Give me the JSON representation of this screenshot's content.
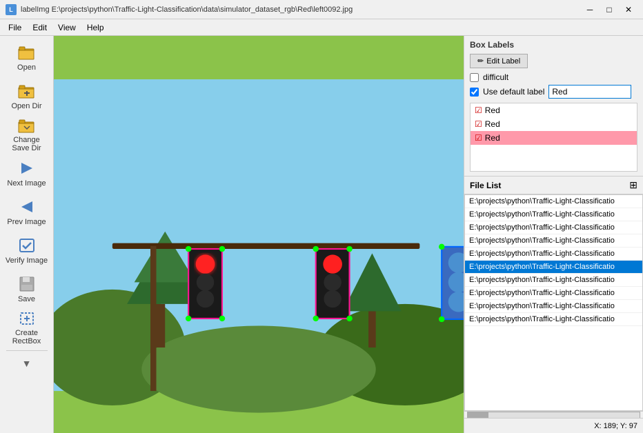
{
  "titleBar": {
    "icon": "L",
    "title": "labelImg  E:\\projects\\python\\Traffic-Light-Classification\\data\\simulator_dataset_rgb\\Red\\left0092.jpg",
    "controls": [
      "─",
      "□",
      "✕"
    ]
  },
  "menuBar": {
    "items": [
      "File",
      "Edit",
      "View",
      "Help"
    ]
  },
  "toolbar": {
    "items": [
      {
        "id": "open",
        "label": "Open",
        "icon": "open"
      },
      {
        "id": "opendir",
        "label": "Open Dir",
        "icon": "opendir"
      },
      {
        "id": "changedir",
        "label": "Change Save Dir",
        "icon": "changedir"
      },
      {
        "id": "next",
        "label": "Next Image",
        "icon": "next"
      },
      {
        "id": "prev",
        "label": "Prev Image",
        "icon": "prev"
      },
      {
        "id": "verify",
        "label": "Verify Image",
        "icon": "verify"
      },
      {
        "id": "save",
        "label": "Save",
        "icon": "save"
      },
      {
        "id": "create",
        "label": "Create RectBox",
        "icon": "create"
      }
    ]
  },
  "rightPanel": {
    "boxLabels": {
      "title": "Box Labels",
      "editLabelBtn": "Edit Label",
      "difficultLabel": "difficult",
      "difficultChecked": false,
      "useDefaultLabel": "Use default label",
      "useDefaultChecked": true,
      "defaultLabelValue": "Red",
      "labels": [
        {
          "text": "Red",
          "checked": true,
          "selected": false
        },
        {
          "text": "Red",
          "checked": true,
          "selected": false
        },
        {
          "text": "Red",
          "checked": true,
          "selected": true
        }
      ]
    },
    "fileList": {
      "title": "File List",
      "items": [
        {
          "text": "E:\\projects\\python\\Traffic-Light-Classificatio",
          "selected": false
        },
        {
          "text": "E:\\projects\\python\\Traffic-Light-Classificatio",
          "selected": false
        },
        {
          "text": "E:\\projects\\python\\Traffic-Light-Classificatio",
          "selected": false
        },
        {
          "text": "E:\\projects\\python\\Traffic-Light-Classificatio",
          "selected": false
        },
        {
          "text": "E:\\projects\\python\\Traffic-Light-Classificatio",
          "selected": false
        },
        {
          "text": "E:\\projects\\python\\Traffic-Light-Classificatio",
          "selected": true
        },
        {
          "text": "E:\\projects\\python\\Traffic-Light-Classificatio",
          "selected": false
        },
        {
          "text": "E:\\projects\\python\\Traffic-Light-Classificatio",
          "selected": false
        },
        {
          "text": "E:\\projects\\python\\Traffic-Light-Classificatio",
          "selected": false
        },
        {
          "text": "E:\\projects\\python\\Traffic-Light-Classificatio",
          "selected": false
        }
      ]
    }
  },
  "statusBar": {
    "coords": "X: 189; Y: 97"
  },
  "colors": {
    "selectedLabel": "#ff99aa",
    "accent": "#0078d4"
  }
}
